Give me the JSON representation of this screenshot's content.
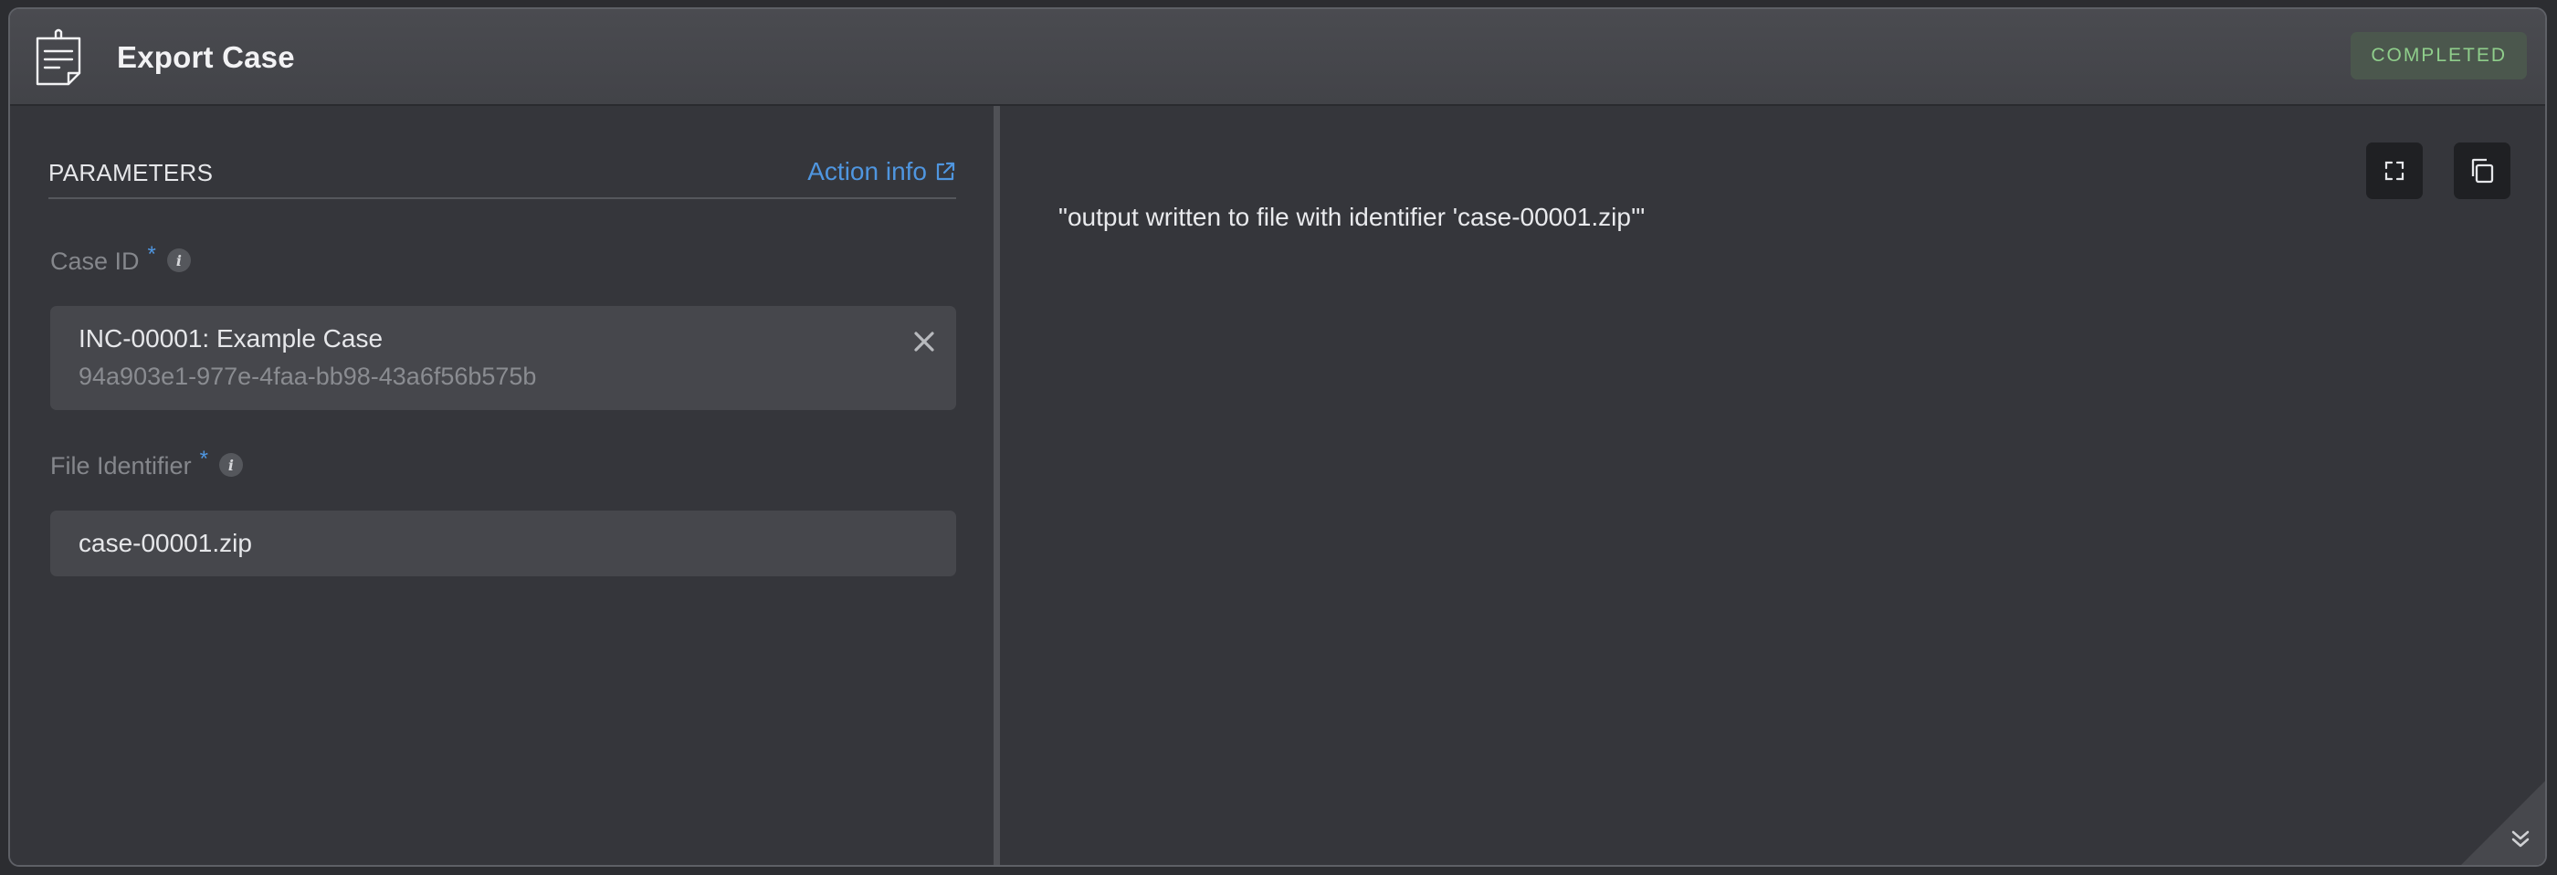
{
  "window": {
    "title": "Export Case",
    "status": "COMPLETED",
    "icon": "clipboard-note-icon"
  },
  "parameters": {
    "section_title": "PARAMETERS",
    "action_info_label": "Action info",
    "action_info_icon": "external-link-icon",
    "case_id": {
      "label": "Case ID",
      "required_mark": "*",
      "info_glyph": "i",
      "selected_title": "INC-00001: Example Case",
      "selected_uuid": "94a903e1-977e-4faa-bb98-43a6f56b575b",
      "clear_icon": "close-icon"
    },
    "file_identifier": {
      "label": "File Identifier",
      "required_mark": "*",
      "info_glyph": "i",
      "value": "case-00001.zip"
    }
  },
  "output": {
    "text": "\"output written to file with identifier 'case-00001.zip'\"",
    "expand_icon": "expand-icon",
    "copy_icon": "copy-icon",
    "collapse_icon": "chevron-double-down-icon"
  },
  "colors": {
    "accent": "#4f96e0",
    "status_text": "#8fce8b",
    "status_bg": "#4b574d"
  }
}
